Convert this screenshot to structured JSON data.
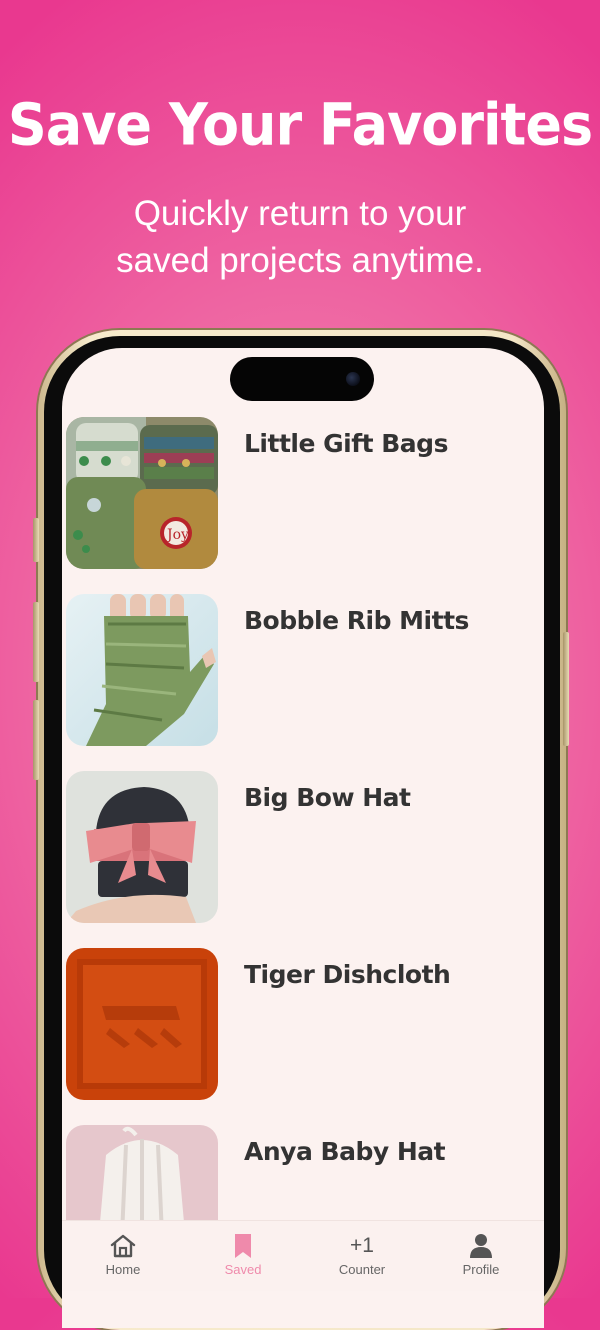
{
  "promo": {
    "headline": "Save Your Favorites",
    "subhead_line1": "Quickly return to your",
    "subhead_line2": "saved projects anytime."
  },
  "saved_list": {
    "items": [
      {
        "title": "Little Gift Bags",
        "thumbnail_icon": "knit-gift-bags-photo"
      },
      {
        "title": "Bobble Rib Mitts",
        "thumbnail_icon": "knit-mitts-photo"
      },
      {
        "title": "Big Bow Hat",
        "thumbnail_icon": "knit-bow-hat-photo"
      },
      {
        "title": "Tiger Dishcloth",
        "thumbnail_icon": "knit-dishcloth-photo"
      },
      {
        "title": "Anya Baby Hat",
        "thumbnail_icon": "knit-baby-hat-photo"
      }
    ]
  },
  "tabbar": {
    "tabs": [
      {
        "label": "Home",
        "icon": "home-icon",
        "active": false
      },
      {
        "label": "Saved",
        "icon": "bookmark-icon",
        "active": true
      },
      {
        "label": "Counter",
        "icon": "plus-one-icon",
        "glyph": "+1",
        "active": false
      },
      {
        "label": "Profile",
        "icon": "person-icon",
        "active": false
      }
    ]
  },
  "colors": {
    "background_pink": "#ee5a9c",
    "screen_background": "#fcf2f0",
    "active_tab": "#ef8aab",
    "title_text": "#333333"
  }
}
